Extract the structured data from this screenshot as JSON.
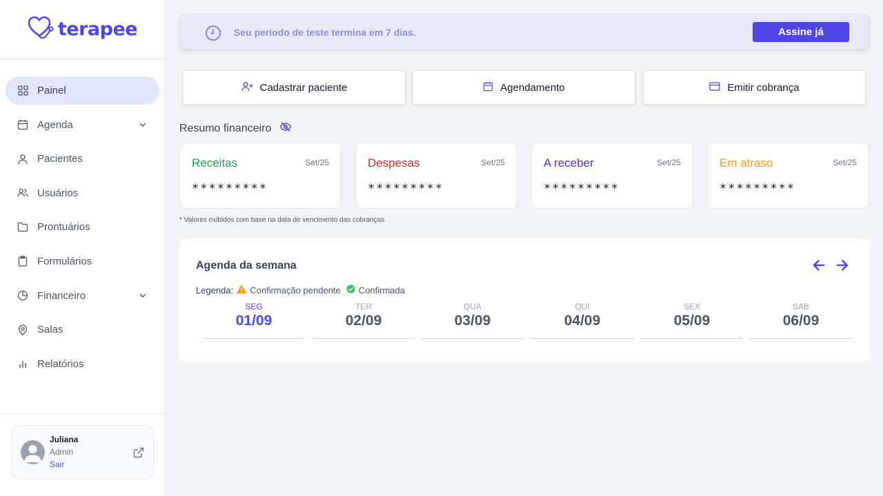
{
  "app": {
    "logo_text": "terapee"
  },
  "sidebar": {
    "items": [
      {
        "label": "Painel",
        "icon": "grid-icon"
      },
      {
        "label": "Agenda",
        "icon": "calendar-icon"
      },
      {
        "label": "Pacientes",
        "icon": "user-icon"
      },
      {
        "label": "Usuários",
        "icon": "users-icon"
      },
      {
        "label": "Prontuários",
        "icon": "folder-icon"
      },
      {
        "label": "Formulários",
        "icon": "clipboard-icon"
      },
      {
        "label": "Financeiro",
        "icon": "pie-chart-icon"
      },
      {
        "label": "Salas",
        "icon": "map-pin-icon"
      },
      {
        "label": "Relatórios",
        "icon": "bar-chart-icon"
      }
    ]
  },
  "user": {
    "name": "Juliana",
    "role": "Admin",
    "logout": "Sair"
  },
  "banner": {
    "text": "Seu período de teste termina em 7 dias.",
    "button": "Assine já"
  },
  "actions": [
    {
      "label": "Cadastrar paciente",
      "icon": "user-plus-icon"
    },
    {
      "label": "Agendamento",
      "icon": "calendar-icon"
    },
    {
      "label": "Emitir cobrança",
      "icon": "credit-card-icon"
    }
  ],
  "finance": {
    "title": "Resumo financeiro",
    "cards": [
      {
        "label": "Receitas",
        "period": "Set/25",
        "value": "*********",
        "color": "#16a34a"
      },
      {
        "label": "Despesas",
        "period": "Set/25",
        "value": "*********",
        "color": "#dc2626"
      },
      {
        "label": "A receber",
        "period": "Set/25",
        "value": "*********",
        "color": "#4338ca"
      },
      {
        "label": "Em atraso",
        "period": "Set/25",
        "value": "*********",
        "color": "#f59e0b"
      }
    ],
    "footnote": "* Valores exibidos com base na data de vencimento das cobranças"
  },
  "week": {
    "title": "Agenda da semana",
    "legend_label": "Legenda:",
    "legend_pending": "Confirmação pendente",
    "legend_confirmed": "Confirmada",
    "days": [
      {
        "name": "SEG",
        "date": "01/09"
      },
      {
        "name": "TER",
        "date": "02/09"
      },
      {
        "name": "QUA",
        "date": "03/09"
      },
      {
        "name": "QUI",
        "date": "04/09"
      },
      {
        "name": "SEX",
        "date": "05/09"
      },
      {
        "name": "SAB",
        "date": "06/09"
      }
    ]
  },
  "colors": {
    "accent": "#4f46e5",
    "pending": "#f59e0b",
    "confirmed": "#22c55e"
  }
}
